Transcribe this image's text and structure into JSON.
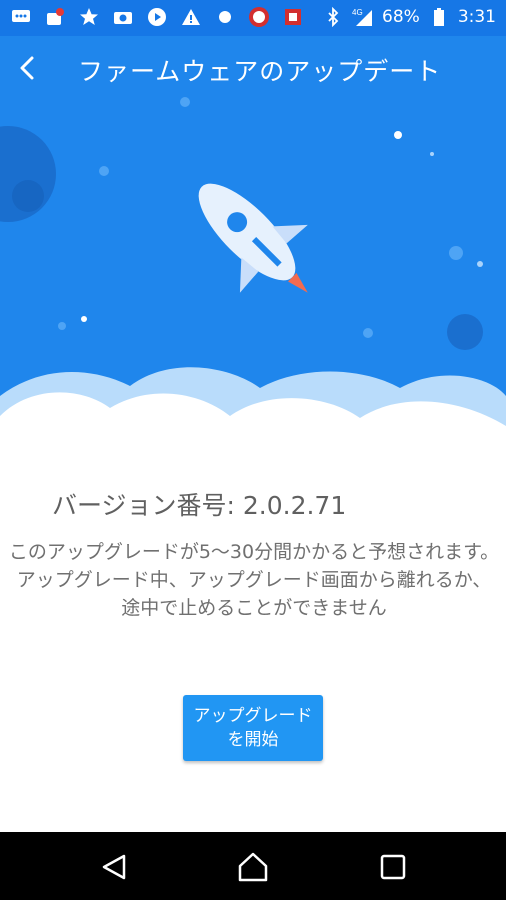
{
  "statusbar": {
    "time": "3:31",
    "battery": "68%",
    "network": "4G",
    "left_icons": [
      "chat-icon",
      "notification-icon",
      "star-icon",
      "camera-icon",
      "play-icon",
      "warning-icon",
      "dot-icon",
      "app-badge-icon",
      "app-badge2-icon"
    ],
    "right_icons": [
      "bluetooth-icon",
      "signal-icon",
      "battery-icon"
    ]
  },
  "appbar": {
    "title": "ファームウェアのアップデート",
    "back_icon": "back-arrow-icon"
  },
  "version": "バージョン番号: 2.0.2.71",
  "description": "このアップグレードが5〜30分間かかると予想されます。 アップグレード中、アップグレード画面から離れるか、途中で止めることができません",
  "start_button": {
    "line1": "アップグレード",
    "line2": "を開始"
  },
  "navbar": {
    "back": "nav-back-icon",
    "home": "nav-home-icon",
    "recents": "nav-recents-icon"
  },
  "colors": {
    "primary": "#2196f3",
    "hero_bg": "#1f86ec",
    "statusbar": "#1677e6"
  }
}
